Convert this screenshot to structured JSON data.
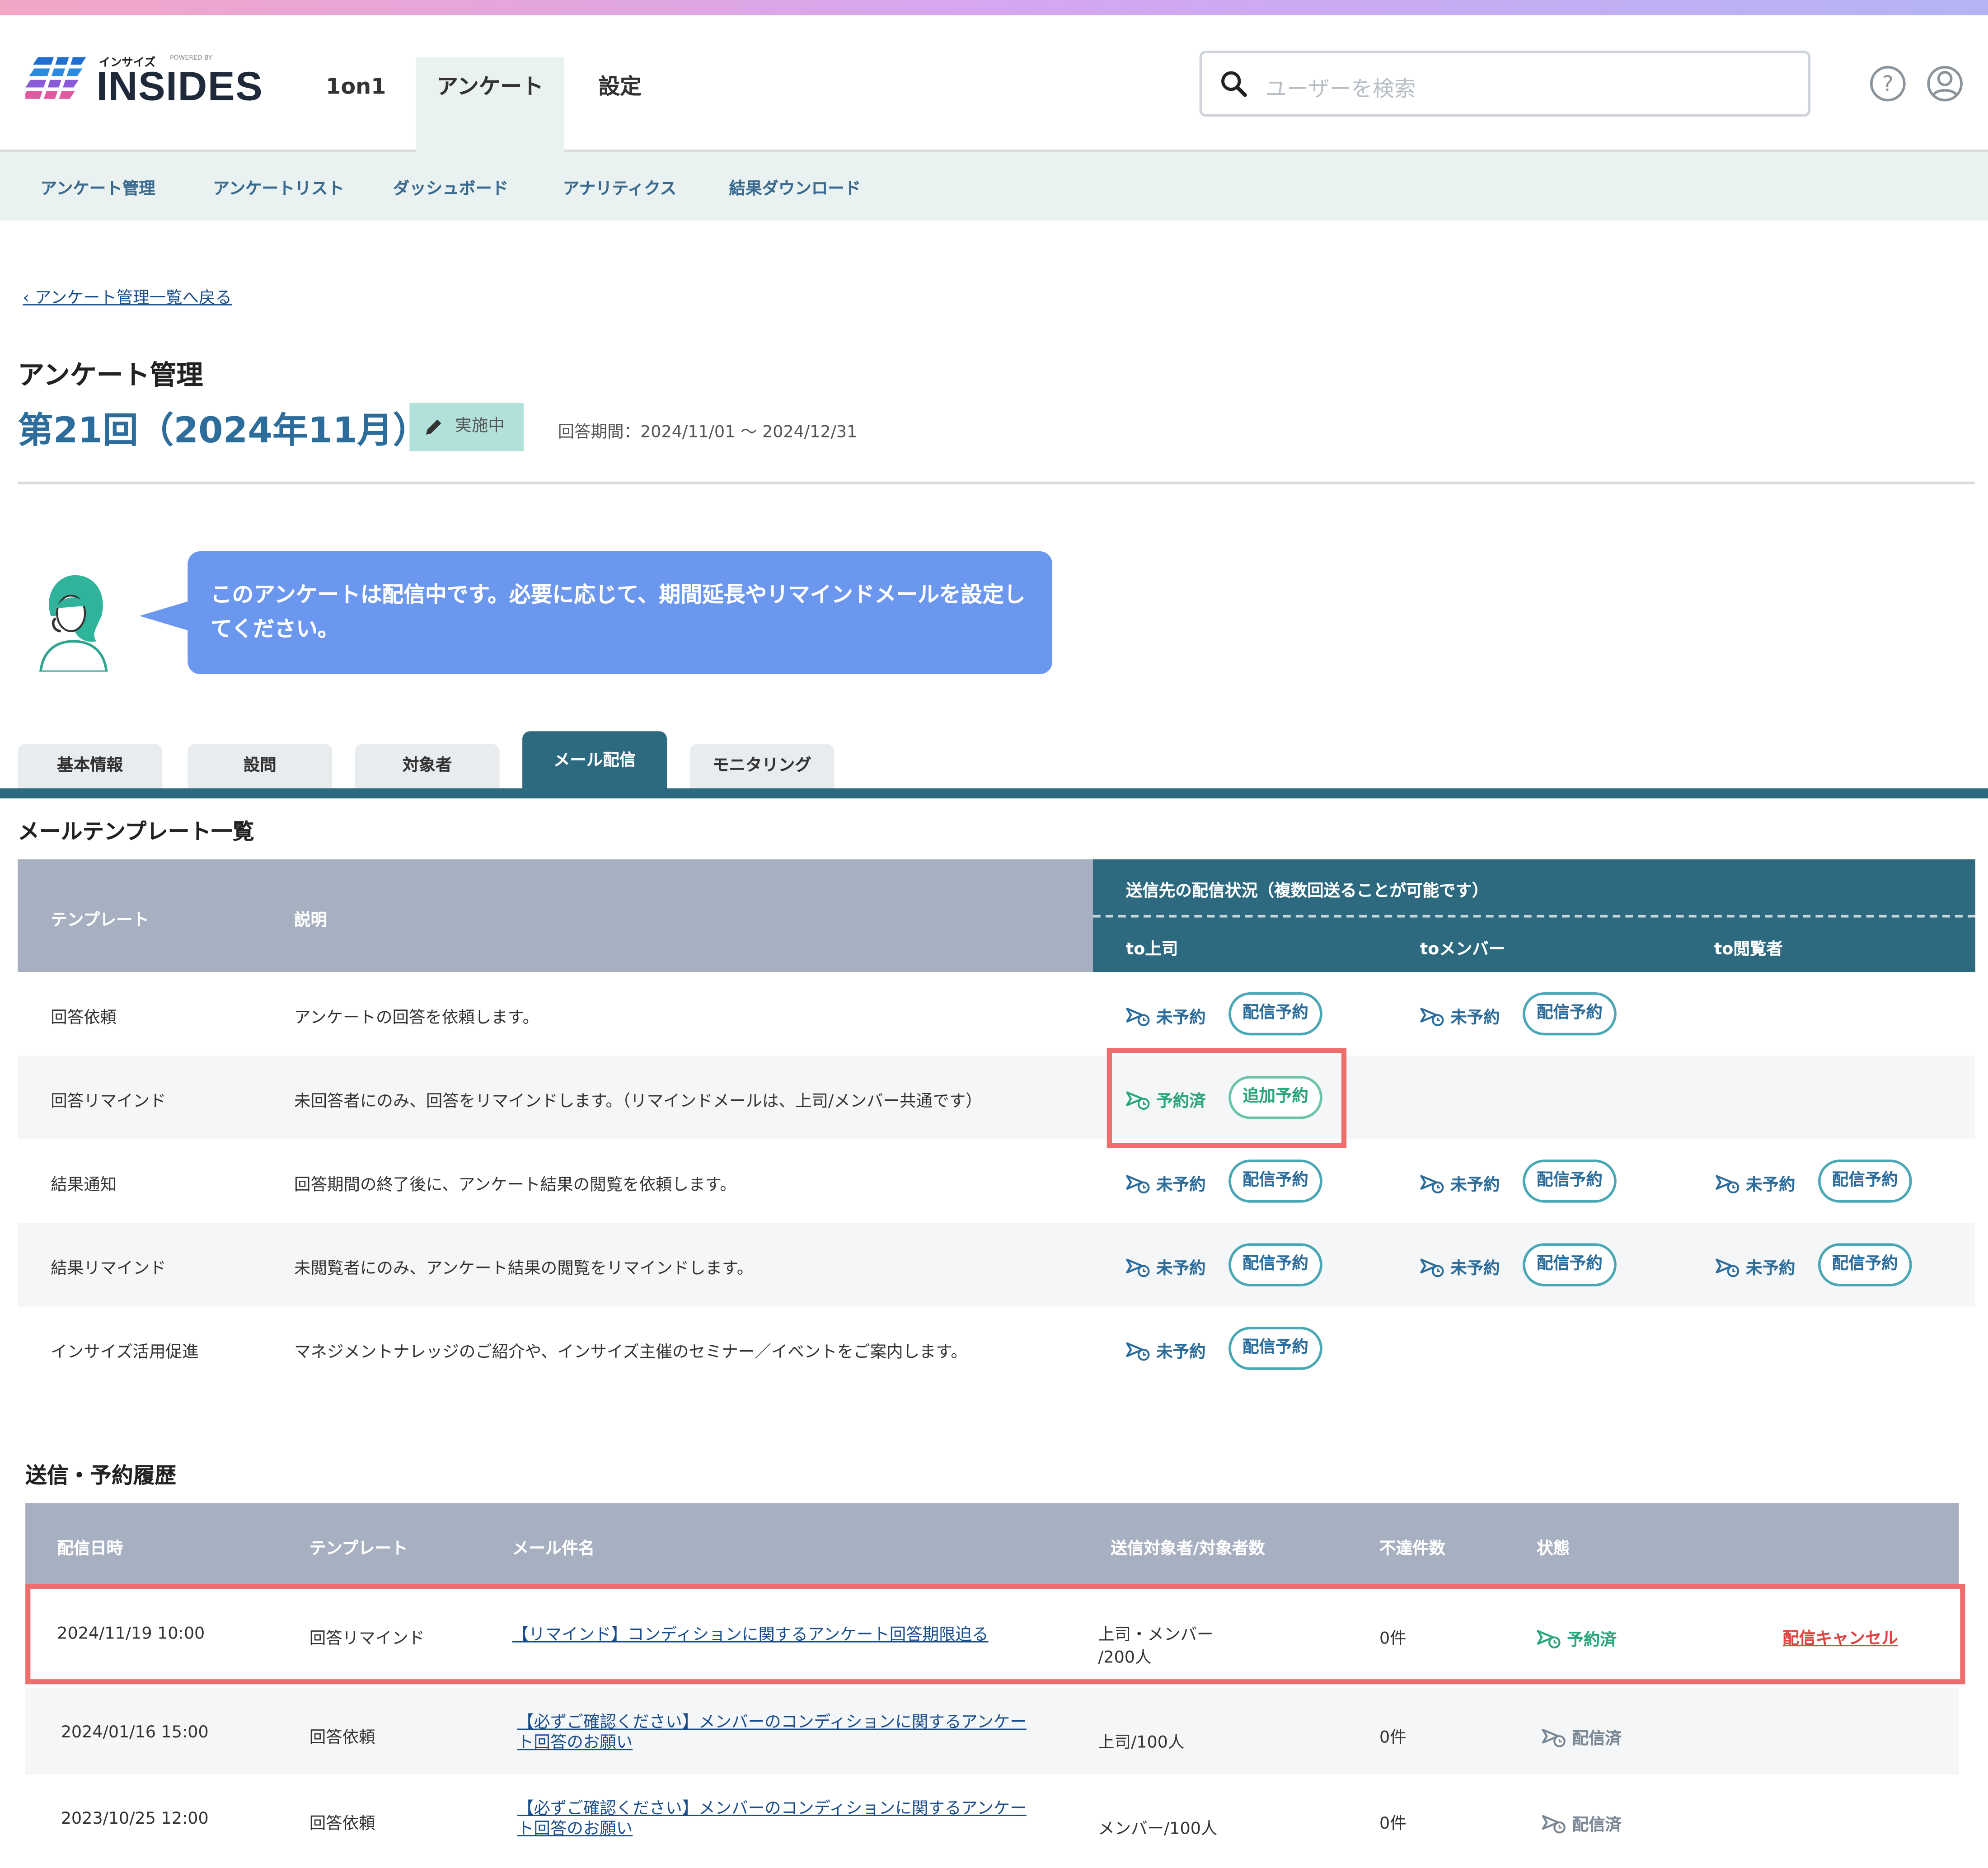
{
  "header": {
    "logo_kana": "インサイズ",
    "logo_powered": "POWERED BY",
    "logo_name": "INSIDES",
    "nav": [
      "1on1",
      "アンケート",
      "設定"
    ],
    "search_placeholder": "ユーザーを検索"
  },
  "subnav": [
    "アンケート管理",
    "アンケートリスト",
    "ダッシュボード",
    "アナリティクス",
    "結果ダウンロード"
  ],
  "breadcrumb": "アンケート管理一覧へ戻る",
  "page_title": "アンケート管理",
  "survey": {
    "title": "第21回（2024年11月）",
    "status": "実施中",
    "period": "回答期間：2024/11/01 ～ 2024/12/31"
  },
  "message": "このアンケートは配信中です。必要に応じて、期間延長やリマインドメールを設定してください。",
  "tabs": [
    "基本情報",
    "設問",
    "対象者",
    "メール配信",
    "モニタリング"
  ],
  "templates": {
    "section_title": "メールテンプレート一覧",
    "col_template": "テンプレート",
    "col_desc": "説明",
    "col_status": "送信先の配信状況（複数回送ることが可能です）",
    "col_to": [
      "to上司",
      "toメンバー",
      "to閲覧者"
    ],
    "rows": [
      {
        "name": "回答依頼",
        "desc": "アンケートの回答を依頼します。",
        "cells": [
          {
            "status": "未予約",
            "button": "配信予約"
          },
          {
            "status": "未予約",
            "button": "配信予約"
          },
          null
        ]
      },
      {
        "name": "回答リマインド",
        "desc": "未回答者にのみ、回答をリマインドします。（リマインドメールは、上司/メンバー共通です）",
        "cells": [
          {
            "status": "予約済",
            "button": "追加予約"
          },
          null,
          null
        ]
      },
      {
        "name": "結果通知",
        "desc": "回答期間の終了後に、アンケート結果の閲覧を依頼します。",
        "cells": [
          {
            "status": "未予約",
            "button": "配信予約"
          },
          {
            "status": "未予約",
            "button": "配信予約"
          },
          {
            "status": "未予約",
            "button": "配信予約"
          }
        ]
      },
      {
        "name": "結果リマインド",
        "desc": "未閲覧者にのみ、アンケート結果の閲覧をリマインドします。",
        "cells": [
          {
            "status": "未予約",
            "button": "配信予約"
          },
          {
            "status": "未予約",
            "button": "配信予約"
          },
          {
            "status": "未予約",
            "button": "配信予約"
          }
        ]
      },
      {
        "name": "インサイズ活用促進",
        "desc": "マネジメントナレッジのご紹介や、インサイズ主催のセミナー／イベントをご案内します。",
        "cells": [
          {
            "status": "未予約",
            "button": "配信予約"
          },
          null,
          null
        ]
      }
    ]
  },
  "history": {
    "section_title": "送信・予約履歴",
    "cols": [
      "配信日時",
      "テンプレート",
      "メール件名",
      "送信対象者/対象者数",
      "不達件数",
      "状態"
    ],
    "rows": [
      {
        "date": "2024/11/19 10:00",
        "template": "回答リマインド",
        "subject1": "【リマインド】コンディションに関するアンケート回答期限迫る",
        "subject2": "",
        "target1": "上司・メンバー",
        "target2": "/200人",
        "undelivered": "0件",
        "status": "予約済",
        "action": "配信キャンセル"
      },
      {
        "date": "2024/01/16 15:00",
        "template": "回答依頼",
        "subject1": "【必ずご確認ください】メンバーのコンディションに関するアンケー",
        "subject2": "ト回答のお願い",
        "target1": "上司/100人",
        "target2": "",
        "undelivered": "0件",
        "status": "配信済",
        "action": ""
      },
      {
        "date": "2023/10/25 12:00",
        "template": "回答依頼",
        "subject1": "【必ずご確認ください】メンバーのコンディションに関するアンケー",
        "subject2": "ト回答のお願い",
        "target1": "メンバー/100人",
        "target2": "",
        "undelivered": "0件",
        "status": "配信済",
        "action": ""
      }
    ]
  },
  "colors": {
    "accent": "#2d6a80",
    "highlight": "#ee6e6e",
    "bubble": "#6c97ee",
    "done": "#2aa57c"
  }
}
